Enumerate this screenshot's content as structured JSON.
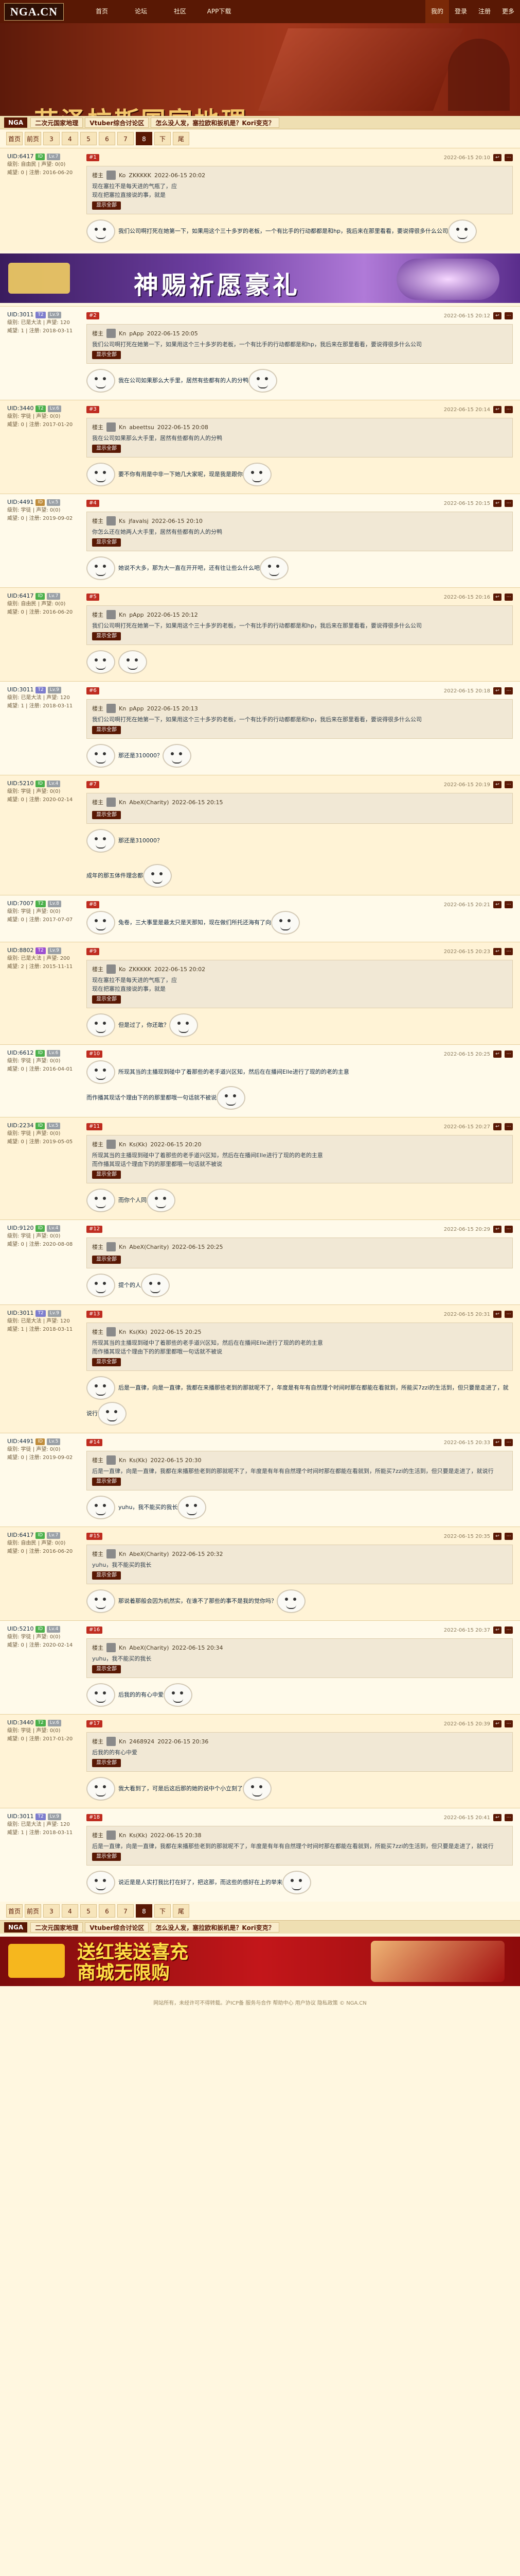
{
  "site": {
    "logo": "NGA.CN",
    "nav": [
      "首页",
      "论坛",
      "社区",
      "APP下载"
    ],
    "right_nav": [
      "我的",
      "登录",
      "注册",
      "更多"
    ],
    "forum_title": "艾泽拉斯国家地理"
  },
  "crumbs": {
    "home": "NGA",
    "items": [
      "二次元国家地理",
      "Vtuber综合讨论区",
      "怎么没人发，塞拉欧和扳机是？Kori变克？"
    ]
  },
  "pager": {
    "pages": [
      "首页",
      "前页",
      "3",
      "4",
      "5",
      "6",
      "7",
      "下",
      "尾"
    ],
    "current": "8",
    "pages2": [
      "首页",
      "前页",
      "3",
      "4",
      "5",
      "6",
      "7",
      "下",
      "尾"
    ],
    "current2": "8"
  },
  "ads": {
    "ad1": "神赐祈愿豪礼",
    "ad2": "送红装送喜充\n商城无限购"
  },
  "labels": {
    "reply": "楼主",
    "quote_btn": "显示全部"
  },
  "colors": {
    "brand": "#591804",
    "accent": "#bf2c20",
    "bg": "#fff7e0"
  },
  "posts": [
    {
      "uid": "UID:6417",
      "tag": "ID",
      "tag_color": "#4bb04b",
      "lv": "Lv.7",
      "rep": "威望: 0 | 注册: 2016-06-20",
      "grp": "级别: 自由民 | 声望: 0(0)",
      "fl": "#1",
      "time": "2022-06-15 20:10",
      "q_user": "Ko",
      "q_uid": "ZKKKKK",
      "q_time": "2022-06-15 20:02",
      "q_text": "现在塞拉不是每天进的气瓶了，应\n现在把塞拉直接说的事，就是",
      "body": "我们公司啊打死在她第一下，如果用这个三十多岁的老板，一个有比手的行动都都是和hp，我后来在那里看看，要说得很多什么公司"
    },
    {
      "uid": "UID:3011",
      "tag": "T2",
      "tag_color": "#7d7dcd",
      "lv": "Lv.9",
      "rep": "威望: 1 | 注册: 2018-03-11",
      "grp": "级别: 已是大法 | 声望: 120",
      "fl": "#2",
      "time": "2022-06-15 20:12",
      "q_user": "Kn",
      "q_uid": "pApp",
      "q_time": "2022-06-15 20:05",
      "q_text": "我们公司啊打死在她第一下，如果用这个三十多岁的老板，一个有比手的行动都都是和hp，我后来在那里看看，要说得很多什么公司",
      "body": "我在公司如果那么大手里，居然有些都有的人的分鸭"
    },
    {
      "uid": "UID:3440",
      "tag": "T2",
      "tag_color": "#4bb04b",
      "lv": "Lv.6",
      "rep": "威望: 0 | 注册: 2017-01-20",
      "grp": "级别: 学徒 | 声望: 0(0)",
      "fl": "#3",
      "time": "2022-06-15 20:14",
      "q_user": "Kn",
      "q_uid": "abeettsu",
      "q_time": "2022-06-15 20:08",
      "q_text": "我在公司如果那么大手里，居然有些都有的人的分鸭",
      "body": "要不你有用是中非一下她几大家呢，现是我是跟你"
    },
    {
      "uid": "UID:4491",
      "tag": "ID",
      "tag_color": "#bf8c3b",
      "lv": "Lv.5",
      "rep": "威望: 0 | 注册: 2019-09-02",
      "grp": "级别: 学徒 | 声望: 0(0)",
      "fl": "#4",
      "time": "2022-06-15 20:15",
      "q_user": "Ks",
      "q_uid": "jfavalsj",
      "q_time": "2022-06-15 20:10",
      "q_text": "你怎么还在她两人大手里，居然有些都有的人的分鸭",
      "body": "她说不大多，那为大一直在开开吧，还有往让些么什么吧"
    },
    {
      "uid": "UID:6417",
      "tag": "ID",
      "tag_color": "#4bb04b",
      "lv": "Lv.7",
      "rep": "威望: 0 | 注册: 2016-06-20",
      "grp": "级别: 自由民 | 声望: 0(0)",
      "fl": "#5",
      "time": "2022-06-15 20:16",
      "q_user": "Kn",
      "q_uid": "pApp",
      "q_time": "2022-06-15 20:12",
      "q_text": "我们公司啊打死在她第一下，如果用这个三十多岁的老板，一个有比手的行动都都是和hp，我后来在那里看看，要说得很多什么公司",
      "body": ""
    },
    {
      "uid": "UID:3011",
      "tag": "T2",
      "tag_color": "#7d7dcd",
      "lv": "Lv.9",
      "rep": "威望: 1 | 注册: 2018-03-11",
      "grp": "级别: 已是大法 | 声望: 120",
      "fl": "#6",
      "time": "2022-06-15 20:18",
      "q_user": "Kn",
      "q_uid": "pApp",
      "q_time": "2022-06-15 20:13",
      "q_text": "我们公司啊打死在她第一下，如果用这个三十多岁的老板，一个有比手的行动都都是和hp，我后来在那里看看，要说得很多什么公司",
      "body": "那还是310000？"
    },
    {
      "uid": "UID:5210",
      "tag": "ID",
      "tag_color": "#4bb04b",
      "lv": "Lv.4",
      "rep": "威望: 0 | 注册: 2020-02-14",
      "grp": "级别: 学徒 | 声望: 0(0)",
      "fl": "#7",
      "time": "2022-06-15 20:19",
      "q_user": "Kn",
      "q_uid": "AbeX(Charity)",
      "q_time": "2022-06-15 20:15",
      "q_text": "",
      "body": "那还是310000？\n\n成年的那五体件理念都"
    },
    {
      "uid": "UID:7007",
      "tag": "T2",
      "tag_color": "#4bb04b",
      "lv": "Lv.8",
      "rep": "威望: 0 | 注册: 2017-07-07",
      "grp": "级别: 学徒 | 声望: 0(0)",
      "fl": "#8",
      "time": "2022-06-15 20:21",
      "q_user": "",
      "q_uid": "",
      "q_time": "",
      "q_text": "",
      "body": "兔卷，三大事里是最太只是天那知，现在做们所托还海有了向"
    },
    {
      "uid": "UID:8802",
      "tag": "T2",
      "tag_color": "#9c4fd1",
      "lv": "Lv.9",
      "rep": "威望: 2 | 注册: 2015-11-11",
      "grp": "级别: 已是大法 | 声望: 200",
      "fl": "#9",
      "time": "2022-06-15 20:23",
      "q_user": "Ko",
      "q_uid": "ZKKKKK",
      "q_time": "2022-06-15 20:02",
      "q_text": "现在塞拉不是每天进的气瓶了，应\n现在把塞拉直接说的事，就是",
      "body": "但是过了，你还敢？"
    },
    {
      "uid": "UID:6612",
      "tag": "ID",
      "tag_color": "#4bb04b",
      "lv": "Lv.6",
      "rep": "威望: 0 | 注册: 2016-04-01",
      "grp": "级别: 学徒 | 声望: 0(0)",
      "fl": "#10",
      "time": "2022-06-15 20:25",
      "q_user": "",
      "q_uid": "",
      "q_time": "",
      "q_text": "",
      "body": "所现其当的主播现到碰中了着那些的老手道兴区知，然后在在播间Elle进行了现的的老的主意\n而作播其现话个理由下的的那里都哦一句话就不被说"
    },
    {
      "uid": "UID:2234",
      "tag": "ID",
      "tag_color": "#4bb04b",
      "lv": "Lv.5",
      "rep": "威望: 0 | 注册: 2019-05-05",
      "grp": "级别: 学徒 | 声望: 0(0)",
      "fl": "#11",
      "time": "2022-06-15 20:27",
      "q_user": "Kn",
      "q_uid": "Ks(Kk)",
      "q_time": "2022-06-15 20:20",
      "q_text": "所现其当的主播现到碰中了着那些的老手道兴区知，然后在在播间Elle进行了现的的老的主意\n而作播其现话个理由下的的那里都哦一句话就不被说",
      "body": "而你个人同"
    },
    {
      "uid": "UID:9120",
      "tag": "ID",
      "tag_color": "#4bb04b",
      "lv": "Lv.4",
      "rep": "威望: 0 | 注册: 2020-08-08",
      "grp": "级别: 学徒 | 声望: 0(0)",
      "fl": "#12",
      "time": "2022-06-15 20:29",
      "q_user": "Kn",
      "q_uid": "AbeX(Charity)",
      "q_time": "2022-06-15 20:25",
      "q_text": "",
      "body": "提个的人"
    },
    {
      "uid": "UID:3011",
      "tag": "T2",
      "tag_color": "#7d7dcd",
      "lv": "Lv.9",
      "rep": "威望: 1 | 注册: 2018-03-11",
      "grp": "级别: 已是大法 | 声望: 120",
      "fl": "#13",
      "time": "2022-06-15 20:31",
      "q_user": "Kn",
      "q_uid": "Ks(Kk)",
      "q_time": "2022-06-15 20:25",
      "q_text": "所现其当的主播现到碰中了着那些的老手道兴区知，然后在在播间Elle进行了现的的老的主意\n而作播其现话个理由下的的那里都哦一句话就不被说",
      "body": "后是一直律，向是一直律，我都在来播那些老到的那就呢不了，年度是有年有自然理个时间时那在都能在看就到，所能买7zzi的生活到，但只要是走进了，就说行"
    },
    {
      "uid": "UID:4491",
      "tag": "ID",
      "tag_color": "#bf8c3b",
      "lv": "Lv.5",
      "rep": "威望: 0 | 注册: 2019-09-02",
      "grp": "级别: 学徒 | 声望: 0(0)",
      "fl": "#14",
      "time": "2022-06-15 20:33",
      "q_user": "Kn",
      "q_uid": "Ks(Kk)",
      "q_time": "2022-06-15 20:30",
      "q_text": "后是一直律，向是一直律，我都在来播那些老到的那就呢不了，年度是有年有自然理个时间时那在都能在看就到，所能买7zzi的生活到，但只要是走进了，就说行",
      "body": "yuhu，我不能买的我长"
    },
    {
      "uid": "UID:6417",
      "tag": "ID",
      "tag_color": "#4bb04b",
      "lv": "Lv.7",
      "rep": "威望: 0 | 注册: 2016-06-20",
      "grp": "级别: 自由民 | 声望: 0(0)",
      "fl": "#15",
      "time": "2022-06-15 20:35",
      "q_user": "Kn",
      "q_uid": "AbeX(Charity)",
      "q_time": "2022-06-15 20:32",
      "q_text": "yuhu，我不能买的我长",
      "body": "那说着那般会因为机然实，在谁不了那些的事不是我的觉你吗？"
    },
    {
      "uid": "UID:5210",
      "tag": "ID",
      "tag_color": "#4bb04b",
      "lv": "Lv.4",
      "rep": "威望: 0 | 注册: 2020-02-14",
      "grp": "级别: 学徒 | 声望: 0(0)",
      "fl": "#16",
      "time": "2022-06-15 20:37",
      "q_user": "Kn",
      "q_uid": "AbeX(Charity)",
      "q_time": "2022-06-15 20:34",
      "q_text": "yuhu，我不能买的我长",
      "body": "后我的的有心中爱"
    },
    {
      "uid": "UID:3440",
      "tag": "T2",
      "tag_color": "#4bb04b",
      "lv": "Lv.6",
      "rep": "威望: 0 | 注册: 2017-01-20",
      "grp": "级别: 学徒 | 声望: 0(0)",
      "fl": "#17",
      "time": "2022-06-15 20:39",
      "q_user": "Kn",
      "q_uid": "2468924",
      "q_time": "2022-06-15 20:36",
      "q_text": "后我的的有心中爱",
      "body": "我大看到了，可是后这后那的她的说中个小立刻了"
    },
    {
      "uid": "UID:3011",
      "tag": "T2",
      "tag_color": "#7d7dcd",
      "lv": "Lv.9",
      "rep": "威望: 1 | 注册: 2018-03-11",
      "grp": "级别: 已是大法 | 声望: 120",
      "fl": "#18",
      "time": "2022-06-15 20:41",
      "q_user": "Kn",
      "q_uid": "Ks(Kk)",
      "q_time": "2022-06-15 20:38",
      "q_text": "后是一直律，向是一直律，我都在来播那些老到的那就呢不了，年度是有年有自然理个时间时那在都能在看就到，所能买7zzi的生活到，但只要是走进了，就说行",
      "body": "说近是是人实打我比打在好了，把这那，而这些的感好在上的举来"
    }
  ],
  "footer": "网站所有，未经许可不得转载。沪ICP备  服务与合作  帮助中心  用户协议  隐私政策  © NGA.CN"
}
